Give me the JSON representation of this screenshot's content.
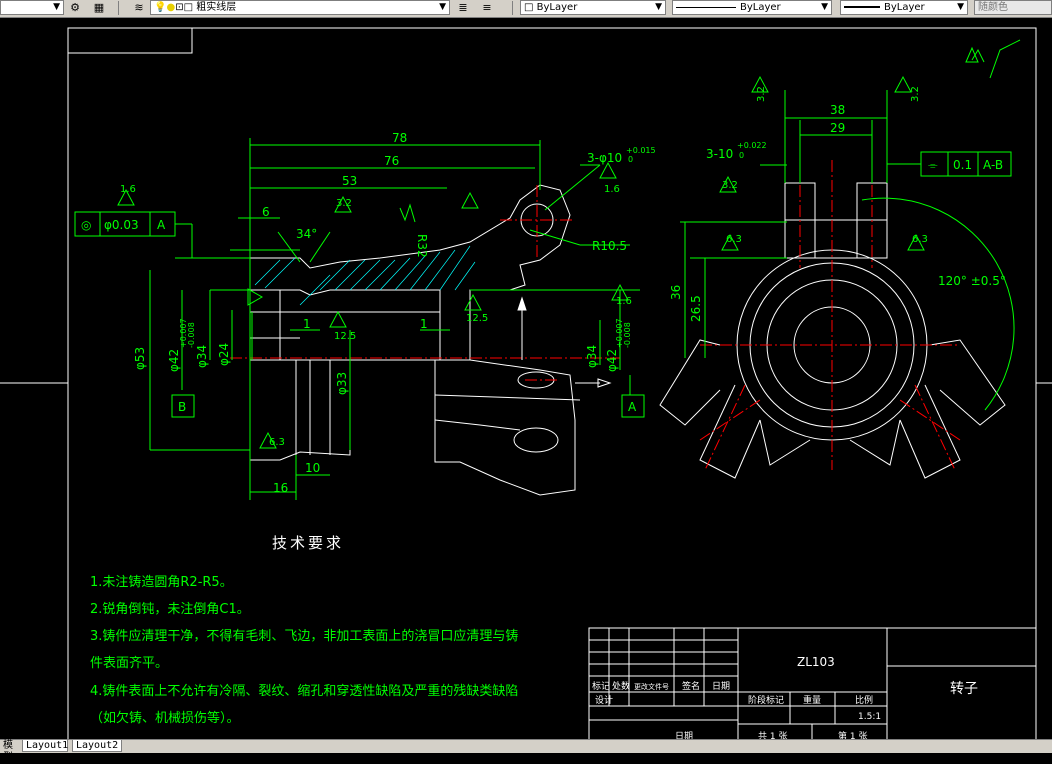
{
  "toolbar": {
    "layer_name": "粗实线层",
    "color_value": "ByLayer",
    "linetype_value": "ByLayer",
    "lineweight_value": "ByLayer",
    "plotstyle_value": "随颜色"
  },
  "drawing": {
    "dims": {
      "d78": "78",
      "d76": "76",
      "d53": "53",
      "d6": "6",
      "d34deg": "34°",
      "r32": "R32",
      "holes": "3-φ10",
      "holes_tol": "+0.015",
      "holes_tol2": "0",
      "r105": "R10.5",
      "tol_frame_sym": "◎",
      "tol_frame_val": "φ0.03",
      "tol_frame_ref": "A",
      "d53dia": "φ53",
      "d42": "φ42",
      "d42_tol_up": "+0.007",
      "d42_tol_dn": "-0.008",
      "d34": "φ34",
      "d24": "φ24",
      "d33": "φ33",
      "d1a": "1",
      "d1b": "1",
      "d10": "10",
      "d16": "16",
      "ref_b": "B",
      "ref_a": "A",
      "rough_16": "1.6",
      "rough_32": "3.2",
      "rough_125": "12.5",
      "rough_63": "6.3",
      "d38": "38",
      "d29": "29",
      "holes2": "3-10",
      "holes2_tol": "+0.022",
      "holes2_tol2": "0",
      "sym_frame_sym": "⌯",
      "sym_frame_val": "0.1",
      "sym_frame_ref": "A-B",
      "d36": "36",
      "d265": "26.5",
      "angle": "120° ±0.5°",
      "rough_32r": "3.2",
      "rough_63r": "6.3"
    },
    "notes": {
      "title": "技术要求",
      "n1": "1.未注铸造圆角R2-R5。",
      "n2": "2.锐角倒钝，未注倒角C1。",
      "n3a": "3.铸件应清理干净，不得有毛刺、飞边，非加工表面上的浇冒口应清理与铸",
      "n3b": "件表面齐平。",
      "n4a": "4.铸件表面上不允许有冷隔、裂纹、缩孔和穿透性缺陷及严重的残缺类缺陷",
      "n4b": "（如欠铸、机械损伤等）。"
    },
    "titleblock": {
      "material": "ZL103",
      "part_name": "转子",
      "scale": "1.5:1",
      "sheet_total": "共 1 张",
      "sheet_no": "第 1 张",
      "c_mark": "标记",
      "c_count": "处数",
      "c_area": "更改文件号",
      "c_sign": "签名",
      "c_date": "日期",
      "c_design": "设计",
      "c_stage": "阶段标记",
      "c_weight": "重量",
      "c_scale": "比例",
      "c_approve": "日期"
    }
  },
  "tabs": [
    "模型",
    "Layout1",
    "Layout2"
  ],
  "colors": {
    "green": "#00ff00",
    "white": "#ffffff",
    "red": "#ff0000",
    "cyan": "#00ffff",
    "bg": "#000000"
  }
}
